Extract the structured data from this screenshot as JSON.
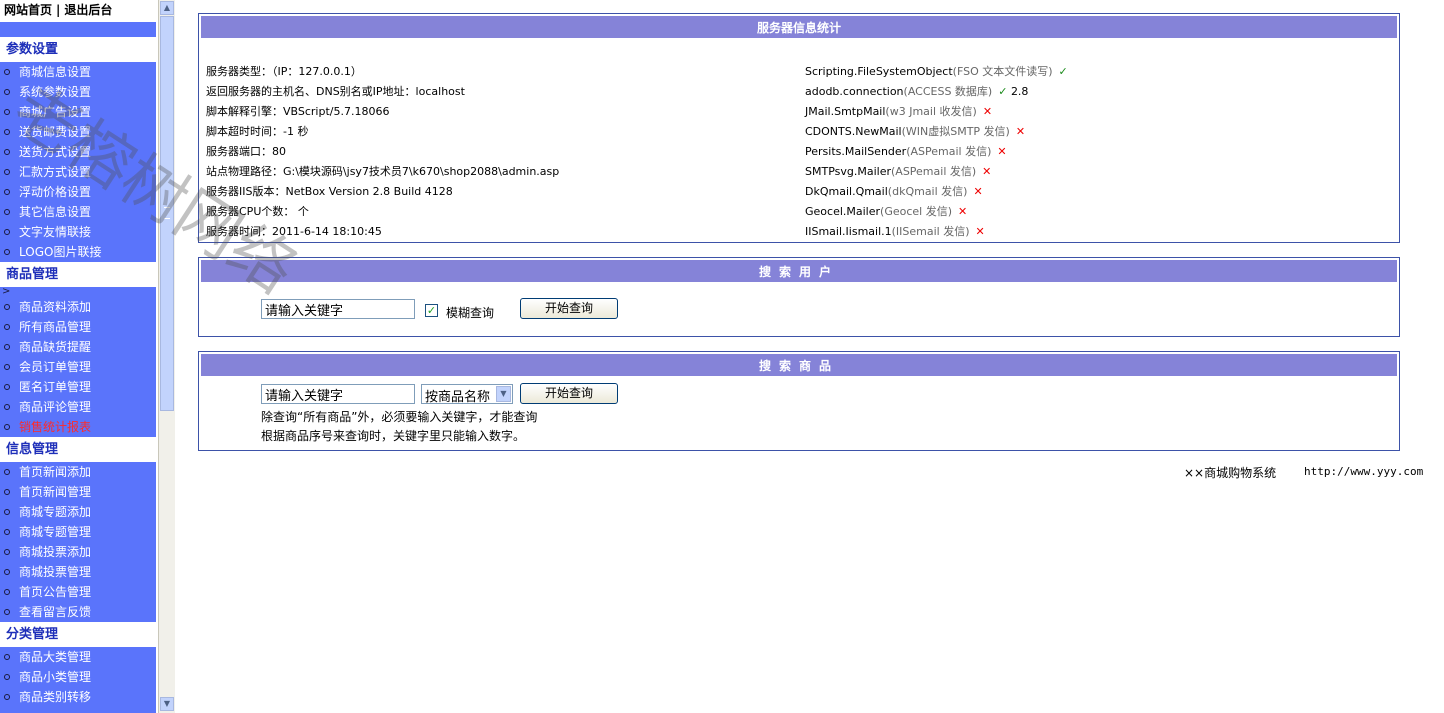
{
  "top_links": {
    "home": "网站首页",
    "separator": "|",
    "logout": "退出后台"
  },
  "sidebar": {
    "sections": [
      {
        "title": "参数设置",
        "items": [
          "商城信息设置",
          "系统参数设置",
          "商城广告设置",
          "送货邮费设置",
          "送货方式设置",
          "汇款方式设置",
          "浮动价格设置",
          "其它信息设置",
          "文字友情联接",
          "LOGO图片联接"
        ]
      },
      {
        "title": "商品管理",
        "arrow": ">",
        "items": [
          "商品资料添加",
          "所有商品管理",
          "商品缺货提醒",
          "会员订单管理",
          "匿名订单管理",
          "商品评论管理",
          "销售统计报表"
        ]
      },
      {
        "title": "信息管理",
        "items": [
          "首页新闻添加",
          "首页新闻管理",
          "商城专题添加",
          "商城专题管理",
          "商城投票添加",
          "商城投票管理",
          "首页公告管理",
          "查看留言反馈"
        ]
      },
      {
        "title": "分类管理",
        "items": [
          "商品大类管理",
          "商品小类管理",
          "商品类别转移"
        ]
      }
    ],
    "highlight_color": "#ff2a2a",
    "bg_color": "#5a74fb"
  },
  "server_info": {
    "title": "服务器信息统计",
    "left": [
      "服务器类型：（IP：127.0.0.1）",
      "返回服务器的主机名、DNS别名或IP地址：localhost",
      "脚本解释引擎：VBScript/5.7.18066",
      "脚本超时时间：-1 秒",
      "服务器端口：80",
      "站点物理路径：G:\\模块源码\\jsy7技术员7\\k670\\shop2088\\admin.asp",
      "服务器IIS版本：NetBox Version 2.8 Build 4128",
      "服务器CPU个数： 个",
      "服务器时间：2011-6-14 18:10:45"
    ],
    "right": [
      {
        "name": "Scripting.FileSystemObject",
        "note": "(FSO 文本文件读写)",
        "mark": "✓",
        "extra": ""
      },
      {
        "name": "adodb.connection",
        "note": "(ACCESS 数据库)",
        "mark": "✓",
        "extra": "2.8"
      },
      {
        "name": "JMail.SmtpMail",
        "note": "(w3 Jmail 收发信)",
        "mark": "✕",
        "extra": ""
      },
      {
        "name": "CDONTS.NewMail",
        "note": "(WIN虚拟SMTP 发信)",
        "mark": "✕",
        "extra": ""
      },
      {
        "name": "Persits.MailSender",
        "note": "(ASPemail 发信)",
        "mark": "✕",
        "extra": ""
      },
      {
        "name": "SMTPsvg.Mailer",
        "note": "(ASPemail 发信)",
        "mark": "✕",
        "extra": ""
      },
      {
        "name": "DkQmail.Qmail",
        "note": "(dkQmail 发信)",
        "mark": "✕",
        "extra": ""
      },
      {
        "name": "Geocel.Mailer",
        "note": "(Geocel 发信)",
        "mark": "✕",
        "extra": ""
      },
      {
        "name": "IISmail.Iismail.1",
        "note": "(IISemail 发信)",
        "mark": "✕",
        "extra": ""
      }
    ]
  },
  "search_user": {
    "title": "搜索用户",
    "input_value": "请输入关键字",
    "fuzzy_label": "模糊查询",
    "fuzzy_checked": true,
    "button": "开始查询"
  },
  "search_product": {
    "title": "搜索商品",
    "input_value": "请输入关键字",
    "select_value": "按商品名称",
    "button": "开始查询",
    "note1": "除查询“所有商品”外，必须要输入关键字，才能查询",
    "note2": "根据商品序号来查询时，关键字里只能输入数字。"
  },
  "footer": {
    "system_name": "××商城购物系统",
    "url": "http://www.yyy.com"
  },
  "watermark": "老榕树网络",
  "colors": {
    "panel_header": "#8583d8",
    "panel_border": "#3d52a8",
    "ok": "#1a8a1a",
    "no": "#e00000"
  }
}
